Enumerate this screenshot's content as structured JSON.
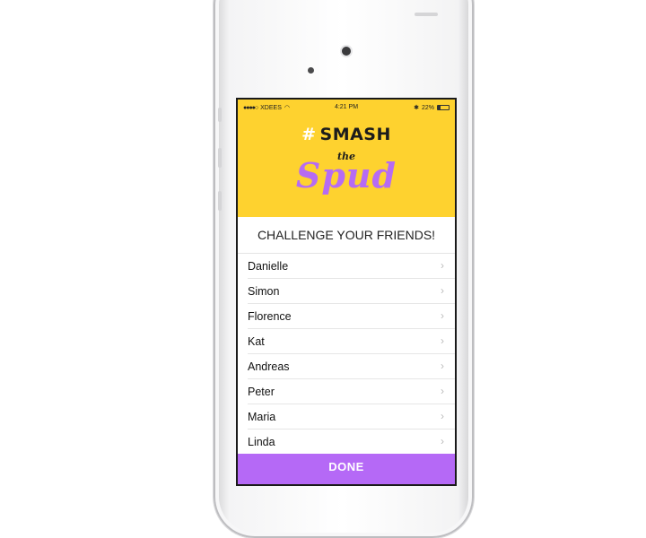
{
  "status_bar": {
    "carrier": "XDEES",
    "time": "4:21 PM",
    "battery": "22%"
  },
  "logo": {
    "hash": "#",
    "smash": "SMASH",
    "the": "the",
    "spud": "Spud"
  },
  "heading": "CHALLENGE YOUR FRIENDS!",
  "friends": [
    {
      "name": "Danielle"
    },
    {
      "name": "Simon"
    },
    {
      "name": "Florence"
    },
    {
      "name": "Kat"
    },
    {
      "name": "Andreas"
    },
    {
      "name": "Peter"
    },
    {
      "name": "Maria"
    },
    {
      "name": "Linda"
    }
  ],
  "done_label": "DONE",
  "colors": {
    "header": "#fed22f",
    "accent": "#b569f6"
  }
}
